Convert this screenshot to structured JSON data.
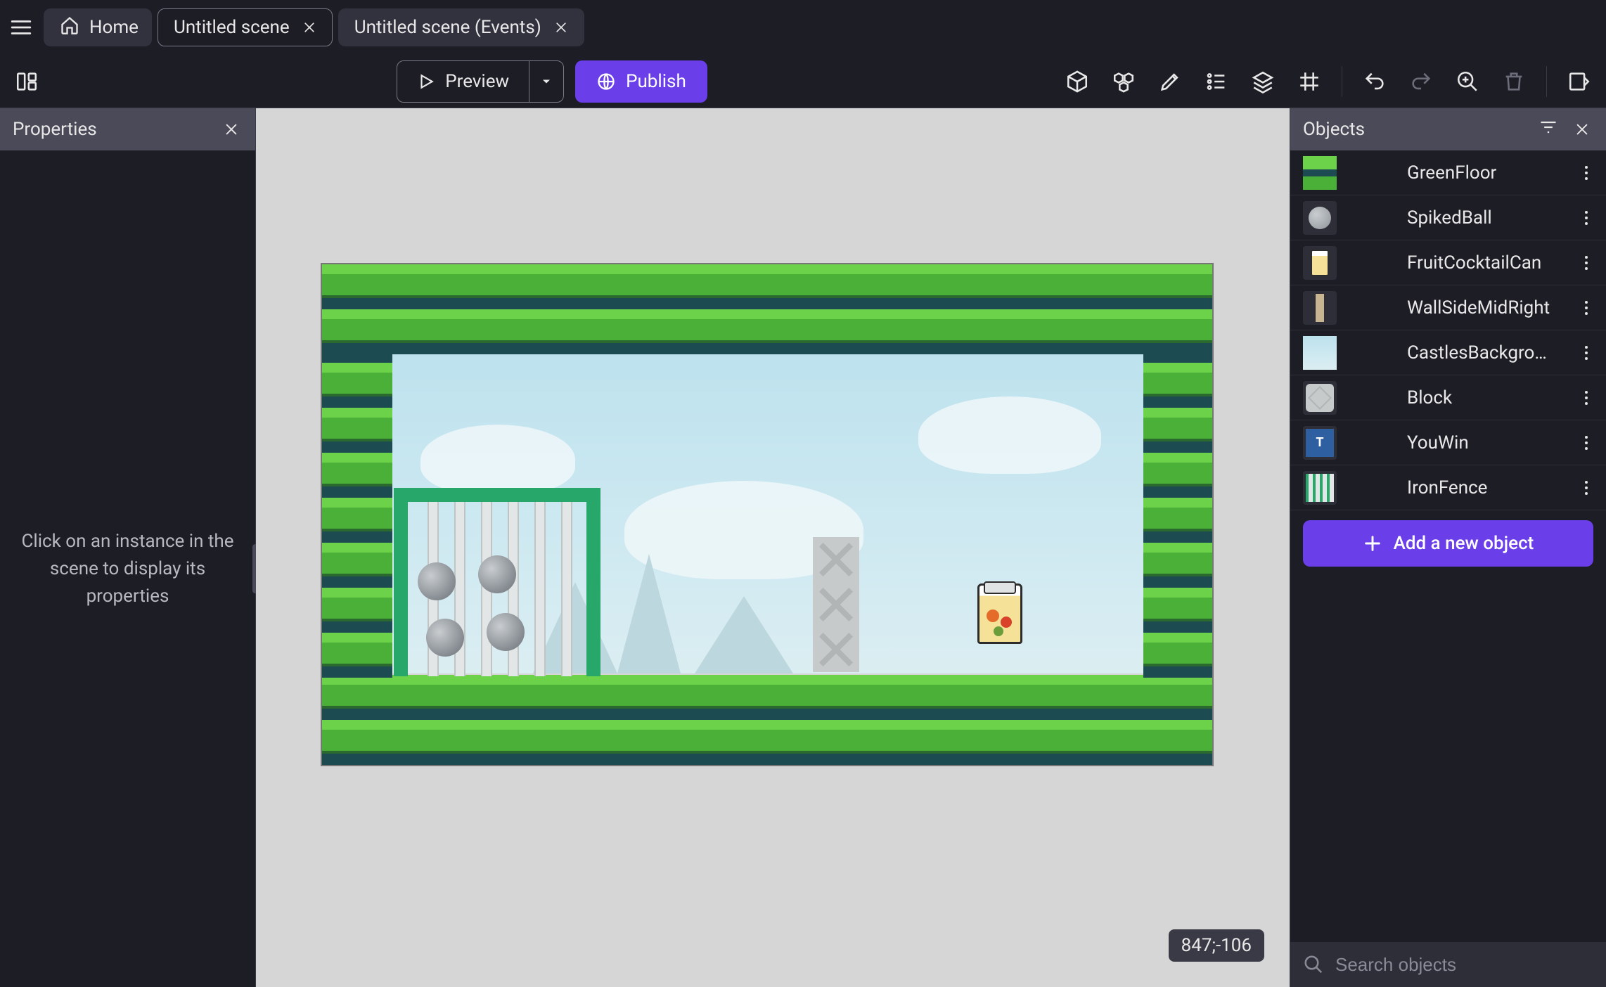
{
  "tabs": {
    "home": "Home",
    "items": [
      {
        "label": "Untitled scene",
        "active": true
      },
      {
        "label": "Untitled scene (Events)",
        "active": false
      }
    ]
  },
  "toolbar": {
    "preview_label": "Preview",
    "publish_label": "Publish"
  },
  "properties_panel": {
    "title": "Properties",
    "placeholder": "Click on an instance in the scene to display its properties"
  },
  "objects_panel": {
    "title": "Objects",
    "items": [
      {
        "name": "GreenFloor"
      },
      {
        "name": "SpikedBall"
      },
      {
        "name": "FruitCocktailCan"
      },
      {
        "name": "WallSideMidRight"
      },
      {
        "name": "CastlesBackgro…"
      },
      {
        "name": "Block"
      },
      {
        "name": "YouWin"
      },
      {
        "name": "IronFence"
      }
    ],
    "add_button": "Add a new object",
    "search_placeholder": "Search objects"
  },
  "scene": {
    "cursor_coords": "847;-106"
  },
  "colors": {
    "accent": "#6a3ee8",
    "panel_header": "#4a4a58",
    "bg_dark": "#1d1d26"
  }
}
